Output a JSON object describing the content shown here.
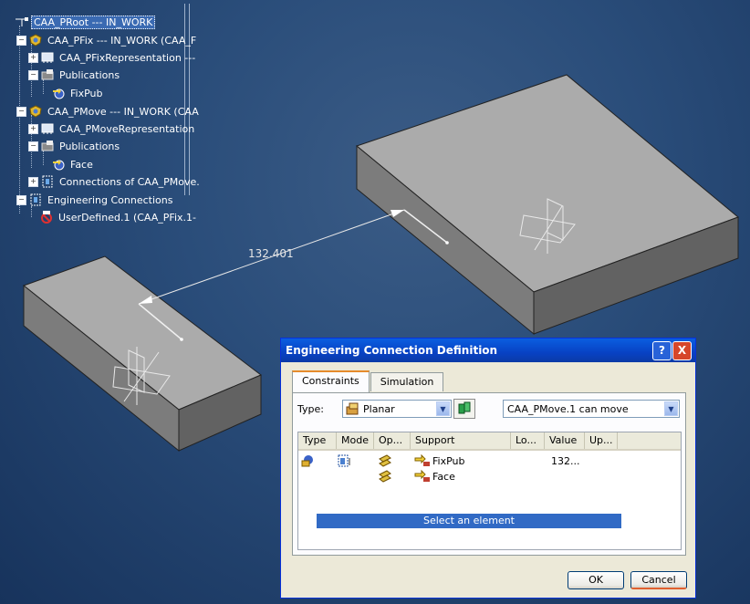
{
  "viewport": {
    "dimension_label": "132.401",
    "colors": {
      "background_center": "#3b5c86",
      "background_edge": "#17335c",
      "block_top": "#a9a9a9",
      "block_side": "#6e6e6e"
    }
  },
  "tree": {
    "root": "CAA_PRoot --- IN_WORK",
    "pfix": "CAA_PFix --- IN_WORK (CAA_F",
    "pfix_rep": "CAA_PFixRepresentation ---",
    "pfix_publications": "Publications",
    "fixpub": "FixPub",
    "pmove": "CAA_PMove --- IN_WORK (CAA",
    "pmove_rep": "CAA_PMoveRepresentation",
    "pmove_publications": "Publications",
    "face": "Face",
    "connections_of": "Connections of CAA_PMove.",
    "engineering_connections": "Engineering Connections",
    "userdefined": "UserDefined.1 (CAA_PFix.1-"
  },
  "dialog": {
    "title": "Engineering Connection Definition",
    "help": "?",
    "close": "X",
    "tabs": [
      "Constraints",
      "Simulation"
    ],
    "type_label": "Type:",
    "type_value": "Planar",
    "move_value": "CAA_PMove.1 can move",
    "columns": [
      "Type",
      "Mode",
      "Op...",
      "Support",
      "Lo...",
      "Value",
      "Up..."
    ],
    "rows": [
      {
        "support": "FixPub",
        "value": "132..."
      },
      {
        "support": "Face",
        "value": ""
      }
    ],
    "select_prompt": "Select an element",
    "ok": "OK",
    "cancel": "Cancel"
  }
}
